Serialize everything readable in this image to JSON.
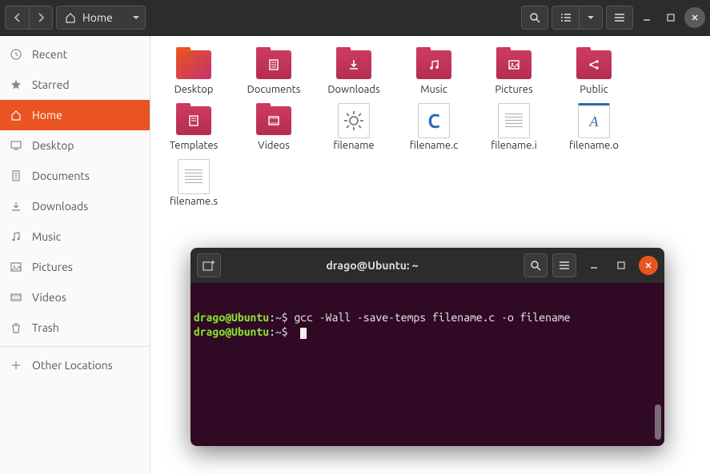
{
  "header": {
    "path_label": "Home"
  },
  "sidebar": {
    "items": [
      {
        "label": "Recent",
        "icon": "clock"
      },
      {
        "label": "Starred",
        "icon": "star"
      },
      {
        "label": "Home",
        "icon": "home",
        "active": true
      },
      {
        "label": "Desktop",
        "icon": "desktop"
      },
      {
        "label": "Documents",
        "icon": "documents"
      },
      {
        "label": "Downloads",
        "icon": "downloads"
      },
      {
        "label": "Music",
        "icon": "music"
      },
      {
        "label": "Pictures",
        "icon": "pictures"
      },
      {
        "label": "Videos",
        "icon": "videos"
      },
      {
        "label": "Trash",
        "icon": "trash"
      }
    ],
    "other": {
      "label": "Other Locations"
    }
  },
  "files": [
    {
      "label": "Desktop",
      "type": "folder-desktop",
      "glyph": ""
    },
    {
      "label": "Documents",
      "type": "folder",
      "glyph": "documents"
    },
    {
      "label": "Downloads",
      "type": "folder",
      "glyph": "download"
    },
    {
      "label": "Music",
      "type": "folder",
      "glyph": "music"
    },
    {
      "label": "Pictures",
      "type": "folder",
      "glyph": "picture"
    },
    {
      "label": "Public",
      "type": "folder",
      "glyph": "share"
    },
    {
      "label": "Templates",
      "type": "folder",
      "glyph": "template"
    },
    {
      "label": "Videos",
      "type": "folder",
      "glyph": "video"
    },
    {
      "label": "filename",
      "type": "cog"
    },
    {
      "label": "filename.c",
      "type": "file-c"
    },
    {
      "label": "filename.i",
      "type": "file-text"
    },
    {
      "label": "filename.o",
      "type": "file-abc"
    },
    {
      "label": "filename.s",
      "type": "file-text"
    }
  ],
  "terminal": {
    "title": "drago@Ubuntu: ~",
    "lines": [
      {
        "user": "drago@Ubuntu",
        "path": "~",
        "cmd": "gcc -Wall -save-temps filename.c -o filename"
      },
      {
        "user": "drago@Ubuntu",
        "path": "~",
        "cmd": ""
      }
    ]
  }
}
